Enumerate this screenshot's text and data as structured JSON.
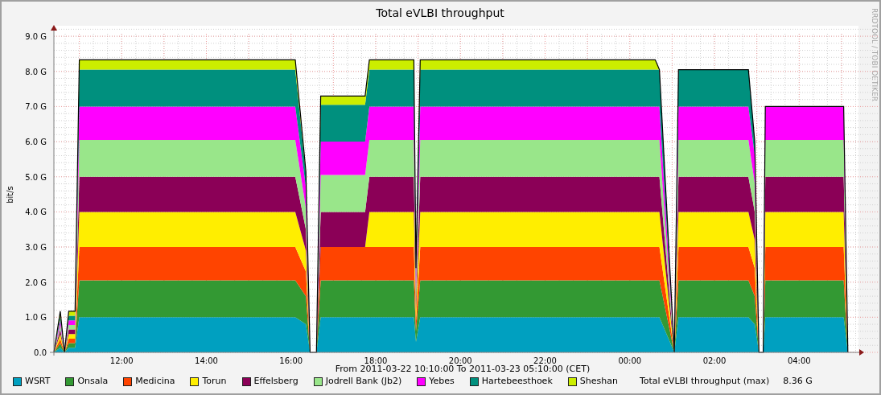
{
  "chart": {
    "side_label": "RRDTOOL / TOBI OETIKER",
    "chart_data": {
      "type": "area",
      "title": "Total eVLBI throughput",
      "ylabel": "bit/s",
      "stacked": true,
      "grid": true,
      "x": [
        "2011-03-22T10:24",
        "2011-03-22T10:33",
        "2011-03-22T10:39",
        "2011-03-22T10:45",
        "2011-03-22T10:54",
        "2011-03-22T11:00",
        "2011-03-22T16:06",
        "2011-03-22T16:21",
        "2011-03-22T16:27",
        "2011-03-22T16:36",
        "2011-03-22T16:42",
        "2011-03-22T17:45",
        "2011-03-22T17:51",
        "2011-03-22T18:54",
        "2011-03-22T18:57",
        "2011-03-22T19:03",
        "2011-03-23T00:36",
        "2011-03-23T00:42",
        "2011-03-23T01:03",
        "2011-03-23T01:09",
        "2011-03-23T02:48",
        "2011-03-23T02:57",
        "2011-03-23T03:03",
        "2011-03-23T03:09",
        "2011-03-23T03:12",
        "2011-03-23T05:03",
        "2011-03-23T05:09"
      ],
      "xlim": [
        "2011-03-22T10:24",
        "2011-03-23T05:24"
      ],
      "ylim": [
        0,
        9.3
      ],
      "xticks": [
        {
          "value": "2011-03-22T12:00",
          "label": "12:00"
        },
        {
          "value": "2011-03-22T14:00",
          "label": "14:00"
        },
        {
          "value": "2011-03-22T16:00",
          "label": "16:00"
        },
        {
          "value": "2011-03-22T18:00",
          "label": "18:00"
        },
        {
          "value": "2011-03-22T20:00",
          "label": "20:00"
        },
        {
          "value": "2011-03-22T22:00",
          "label": "22:00"
        },
        {
          "value": "2011-03-23T00:00",
          "label": "00:00"
        },
        {
          "value": "2011-03-23T02:00",
          "label": "02:00"
        },
        {
          "value": "2011-03-23T04:00",
          "label": "04:00"
        }
      ],
      "yticks": [
        {
          "value": 0,
          "label": "0.0"
        },
        {
          "value": 1,
          "label": "1.0 G"
        },
        {
          "value": 2,
          "label": "2.0 G"
        },
        {
          "value": 3,
          "label": "3.0 G"
        },
        {
          "value": 4,
          "label": "4.0 G"
        },
        {
          "value": 5,
          "label": "5.0 G"
        },
        {
          "value": 6,
          "label": "6.0 G"
        },
        {
          "value": 7,
          "label": "7.0 G"
        },
        {
          "value": 8,
          "label": "8.0 G"
        },
        {
          "value": 9,
          "label": "9.0 G"
        }
      ],
      "series": [
        {
          "name": "WSRT",
          "color": "#00a0c0",
          "values": [
            0,
            0.13,
            0,
            0.13,
            0.13,
            1,
            1,
            0.8,
            0,
            0,
            1,
            1,
            1,
            1,
            0.3,
            1,
            1,
            1,
            0,
            1,
            1,
            0.8,
            0,
            0,
            1,
            1,
            0
          ]
        },
        {
          "name": "Onsala",
          "color": "#339933",
          "values": [
            0,
            0.13,
            0,
            0.13,
            0.13,
            1.05,
            1.05,
            0.8,
            0,
            0,
            1.05,
            1.05,
            1.05,
            1.05,
            0.3,
            1.05,
            1.05,
            1.05,
            0,
            1.05,
            1.05,
            0.8,
            0,
            0,
            1.05,
            1.05,
            0
          ]
        },
        {
          "name": "Medicina",
          "color": "#ff4400",
          "values": [
            0,
            0.13,
            0,
            0.13,
            0.13,
            0.95,
            0.95,
            0.7,
            0,
            0,
            0.95,
            0.95,
            0.95,
            0.95,
            0.3,
            0.95,
            0.95,
            0.95,
            0,
            0.95,
            0.95,
            0.8,
            0,
            0,
            0.95,
            0.95,
            0
          ]
        },
        {
          "name": "Torun",
          "color": "#ffee00",
          "values": [
            0,
            0.13,
            0,
            0.13,
            0.13,
            1,
            1,
            0.6,
            0,
            0,
            0,
            0,
            1,
            1,
            0.3,
            1,
            1,
            1,
            0,
            1,
            1,
            0.8,
            0,
            0,
            1,
            1,
            0
          ]
        },
        {
          "name": "Effelsberg",
          "color": "#8b0057",
          "values": [
            0,
            0.13,
            0,
            0.13,
            0.13,
            1,
            1,
            0.6,
            0,
            0,
            1,
            1,
            1,
            1,
            0.3,
            1,
            1,
            1,
            0,
            1,
            1,
            0.8,
            0,
            0,
            1,
            1,
            0
          ]
        },
        {
          "name": "Jodrell Bank (Jb2)",
          "color": "#99e68a",
          "values": [
            0,
            0.13,
            0,
            0.13,
            0.13,
            1.05,
            1.05,
            0.6,
            0,
            0,
            1.05,
            1.05,
            1.05,
            1.05,
            0.3,
            1.05,
            1.05,
            1.05,
            0,
            1.05,
            1.05,
            0.8,
            0,
            0,
            1.05,
            1.05,
            0
          ]
        },
        {
          "name": "Yebes",
          "color": "#ff00ff",
          "values": [
            0,
            0.13,
            0,
            0.13,
            0.13,
            0.95,
            0.95,
            0.6,
            0,
            0,
            0.95,
            0.95,
            0.95,
            0.95,
            0.3,
            0.95,
            0.95,
            0.95,
            0,
            0.95,
            0.95,
            0.8,
            0,
            0,
            0.95,
            0.95,
            0
          ]
        },
        {
          "name": "Hartebeesthoek",
          "color": "#00907e",
          "values": [
            0,
            0.13,
            0,
            0.13,
            0.13,
            1.05,
            1.05,
            0.4,
            0,
            0,
            1.05,
            1.05,
            1.05,
            1.05,
            0.3,
            1.05,
            1.05,
            1.05,
            0,
            1.05,
            1.05,
            0.4,
            0,
            0,
            0,
            0,
            0
          ]
        },
        {
          "name": "Sheshan",
          "color": "#ccee00",
          "values": [
            0,
            0.13,
            0,
            0.13,
            0.13,
            0.28,
            0.28,
            0.05,
            0,
            0,
            0.25,
            0.25,
            0.28,
            0.28,
            0,
            0.28,
            0.28,
            0,
            0,
            0,
            0,
            0,
            0,
            0,
            0,
            0,
            0
          ]
        }
      ]
    }
  },
  "time_range": "From 2011-03-22 10:10:00 To 2011-03-23 05:10:00 (CET)",
  "total": {
    "label": "Total eVLBI throughput (max)",
    "value": "8.36 G"
  }
}
